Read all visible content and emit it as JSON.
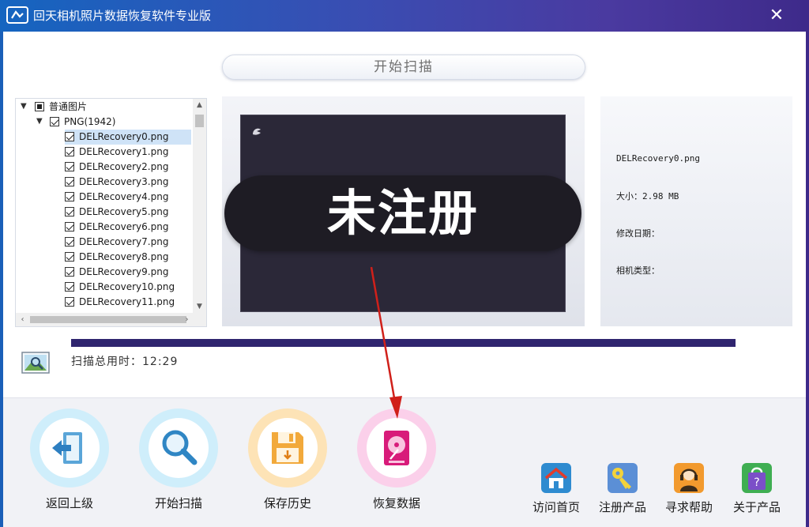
{
  "window": {
    "title": "回天相机照片数据恢复软件专业版",
    "close_glyph": "✕"
  },
  "scan_header": {
    "label": "开始扫描"
  },
  "tree": {
    "root_label": "普通图片",
    "group_label": "PNG(1942)",
    "files": [
      "DELRecovery0.png",
      "DELRecovery1.png",
      "DELRecovery2.png",
      "DELRecovery3.png",
      "DELRecovery4.png",
      "DELRecovery5.png",
      "DELRecovery6.png",
      "DELRecovery7.png",
      "DELRecovery8.png",
      "DELRecovery9.png",
      "DELRecovery10.png",
      "DELRecovery11.png"
    ],
    "selected_index": 0
  },
  "preview": {
    "watermark": "未注册"
  },
  "info": {
    "filename": "DELRecovery0.png",
    "size": "大小：2.98 MB",
    "modified": "修改日期：",
    "camera": "相机类型："
  },
  "progress": {
    "fraction": 1.0,
    "scan_time_label": "扫描总用时：12:29"
  },
  "toolbar": {
    "back_label": "返回上级",
    "scan_label": "开始扫描",
    "history_label": "保存历史",
    "recover_label": "恢复数据",
    "home_label": "访问首页",
    "register_label": "注册产品",
    "help_label": "寻求帮助",
    "about_label": "关于产品"
  },
  "colors": {
    "accent": "#2f256f",
    "title_bar_start": "#1565c0",
    "title_bar_end": "#3e2a8a",
    "back_ring": "#cfeefb",
    "scan_ring": "#cfeefb",
    "history_ring": "#fde3b6",
    "recover_ring": "#fbd0ea",
    "annotation_arrow": "#d0201a"
  },
  "icons": {
    "back": "exit-door-icon",
    "scan": "magnifier-icon",
    "history": "floppy-disk-icon",
    "recover": "hard-disk-icon",
    "home": "house-icon",
    "register": "key-icon",
    "help": "support-headset-icon",
    "about": "shopping-bag-question-icon"
  }
}
